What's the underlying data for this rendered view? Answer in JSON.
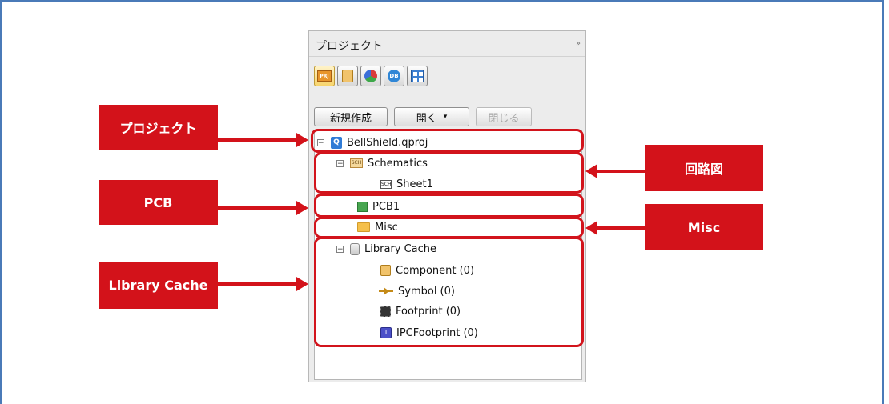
{
  "panel": {
    "title": "プロジェクト",
    "collapse_glyph": "››",
    "tabs": [
      {
        "name": "project-tab",
        "icon": "project-icon",
        "text": "PRJ",
        "active": true
      },
      {
        "name": "component-tab",
        "icon": "component-icon"
      },
      {
        "name": "layers-tab",
        "icon": "layers-icon"
      },
      {
        "name": "database-tab",
        "icon": "database-icon",
        "text": "DB"
      },
      {
        "name": "grid-tab",
        "icon": "grid-icon"
      }
    ],
    "buttons": {
      "new_label": "新規作成",
      "open_label": "開く",
      "open_caret": "▾",
      "close_label": "閉じる"
    }
  },
  "tree": {
    "project": {
      "toggle": "−",
      "icon_text": "Q",
      "label": "BellShield.qproj"
    },
    "schematics": {
      "toggle": "−",
      "icon_text": "SCH",
      "label": "Schematics"
    },
    "sheet": {
      "icon_text": "SCH",
      "label": "Sheet1"
    },
    "pcb": {
      "label": "PCB1"
    },
    "misc": {
      "label": "Misc"
    },
    "library_cache": {
      "toggle": "−",
      "label": "Library Cache"
    },
    "component": {
      "label": "Component (0)"
    },
    "symbol": {
      "label": "Symbol (0)"
    },
    "footprint": {
      "label": "Footprint (0)"
    },
    "ipc_footprint": {
      "icon_text": "I",
      "label": "IPCFootprint (0)"
    }
  },
  "callouts": {
    "project": "プロジェクト",
    "schematic": "回路図",
    "pcb": "PCB",
    "misc": "Misc",
    "library_cache": "Library Cache"
  },
  "colors": {
    "accent_red": "#d3121a",
    "frame_blue": "#4a7ab8"
  }
}
